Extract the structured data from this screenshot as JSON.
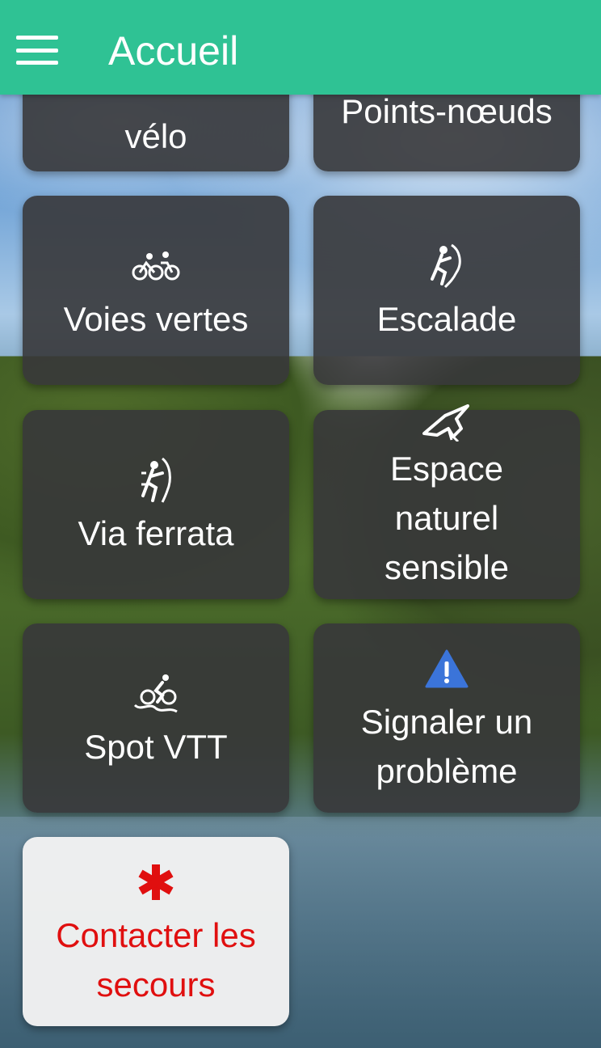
{
  "header": {
    "title": "Accueil",
    "menu_icon": "hamburger-menu-icon"
  },
  "tiles": [
    {
      "label": "vélo",
      "icon": "bike-icon"
    },
    {
      "label": "Points-nœuds",
      "icon": "node-icon"
    },
    {
      "label": "Voies vertes",
      "icon": "cyclists-icon"
    },
    {
      "label": "Escalade",
      "icon": "climber-icon"
    },
    {
      "label": "Via ferrata",
      "icon": "via-ferrata-climber-icon"
    },
    {
      "label_lines": [
        "Espace",
        "naturel",
        "sensible"
      ],
      "icon": "bird-icon"
    },
    {
      "label": "Spot VTT",
      "icon": "mountain-bike-icon"
    },
    {
      "label_lines": [
        "Signaler un",
        "problème"
      ],
      "icon": "warning-icon"
    },
    {
      "label_lines": [
        "Contacter les",
        "secours"
      ],
      "icon": "asterisk-emergency-icon"
    }
  ],
  "colors": {
    "header": "#2fc294",
    "tile": "#37373a",
    "emergency_text": "#e00f0f",
    "warning": "#3b74d9"
  }
}
